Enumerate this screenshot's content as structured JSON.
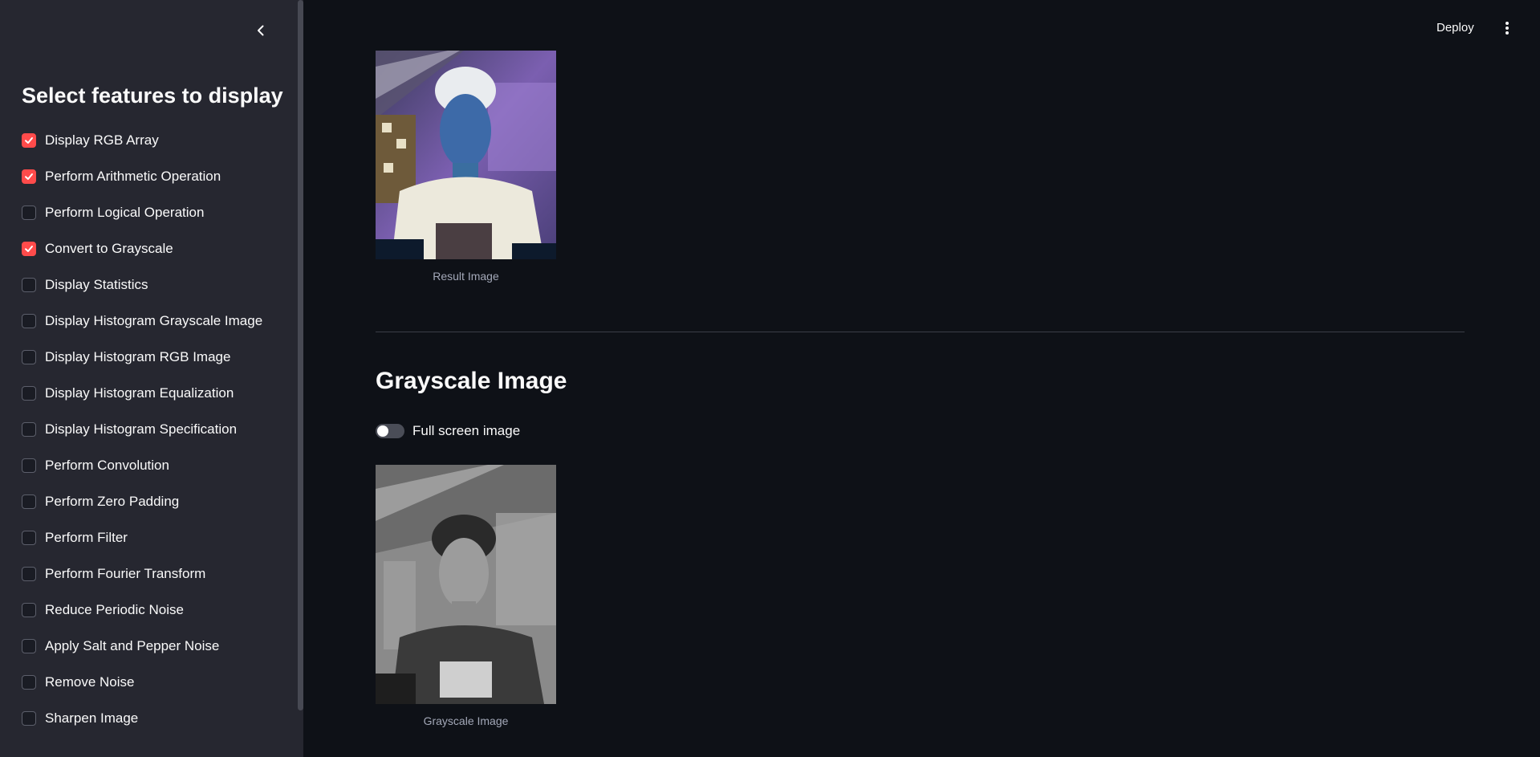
{
  "sidebar": {
    "title": "Select features to display",
    "items": [
      {
        "label": "Display RGB Array",
        "checked": true
      },
      {
        "label": "Perform Arithmetic Operation",
        "checked": true
      },
      {
        "label": "Perform Logical Operation",
        "checked": false
      },
      {
        "label": "Convert to Grayscale",
        "checked": true
      },
      {
        "label": "Display Statistics",
        "checked": false
      },
      {
        "label": "Display Histogram Grayscale Image",
        "checked": false
      },
      {
        "label": "Display Histogram RGB Image",
        "checked": false
      },
      {
        "label": "Display Histogram Equalization",
        "checked": false
      },
      {
        "label": "Display Histogram Specification",
        "checked": false
      },
      {
        "label": "Perform Convolution",
        "checked": false
      },
      {
        "label": "Perform Zero Padding",
        "checked": false
      },
      {
        "label": "Perform Filter",
        "checked": false
      },
      {
        "label": "Perform Fourier Transform",
        "checked": false
      },
      {
        "label": "Reduce Periodic Noise",
        "checked": false
      },
      {
        "label": "Apply Salt and Pepper Noise",
        "checked": false
      },
      {
        "label": "Remove Noise",
        "checked": false
      },
      {
        "label": "Sharpen Image",
        "checked": false
      }
    ]
  },
  "header": {
    "deploy_label": "Deploy"
  },
  "main": {
    "result_caption": "Result Image",
    "grayscale_title": "Grayscale Image",
    "fullscreen_toggle_label": "Full screen image",
    "fullscreen_on": false,
    "grayscale_caption": "Grayscale Image"
  },
  "colors": {
    "accent": "#ff4b4b",
    "background": "#0e1117",
    "sidebar": "#262730"
  }
}
